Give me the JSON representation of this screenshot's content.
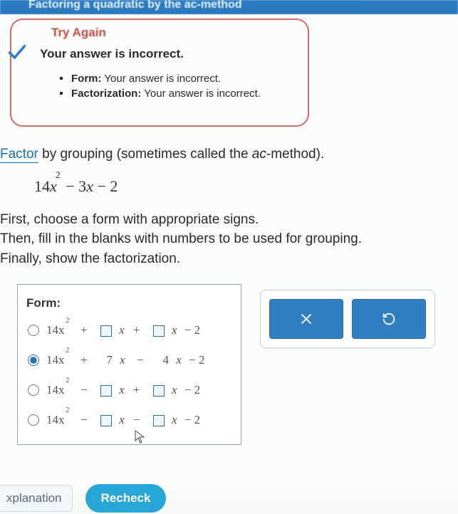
{
  "topbar": {
    "title": "Factoring a quadratic by the ac-method"
  },
  "feedback": {
    "try_again": "Try Again",
    "headline": "Your answer is incorrect.",
    "items": [
      {
        "label": "Form:",
        "msg": "Your answer is incorrect."
      },
      {
        "label": "Factorization:",
        "msg": "Your answer is incorrect."
      }
    ]
  },
  "question": {
    "link_word": "Factor",
    "rest": " by grouping (sometimes called the ",
    "ital": "ac",
    "rest2": "-method).",
    "expression": "14x² − 3x − 2",
    "expr_parts": {
      "a": "14",
      "b": "− 3",
      "c": "− 2"
    },
    "instr1": "First, choose a form with appropriate signs.",
    "instr2": "Then, fill in the blanks with numbers to be used for grouping.",
    "instr3": "Finally, show the factorization."
  },
  "form": {
    "title": "Form:",
    "options": [
      {
        "lead": "14x",
        "op1": "+",
        "v1": "",
        "op2": "+",
        "v2": "",
        "tail": "− 2",
        "selected": false
      },
      {
        "lead": "14x",
        "op1": "+",
        "v1": "7",
        "op2": "−",
        "v2": "4",
        "tail": "− 2",
        "selected": true
      },
      {
        "lead": "14x",
        "op1": "−",
        "v1": "",
        "op2": "+",
        "v2": "",
        "tail": "− 2",
        "selected": false
      },
      {
        "lead": "14x",
        "op1": "−",
        "v1": "",
        "op2": "−",
        "v2": "",
        "tail": "− 2",
        "selected": false
      }
    ]
  },
  "buttons": {
    "clear": "×",
    "reset": "↺"
  },
  "bottom": {
    "explanation": "xplanation",
    "recheck": "Recheck"
  }
}
